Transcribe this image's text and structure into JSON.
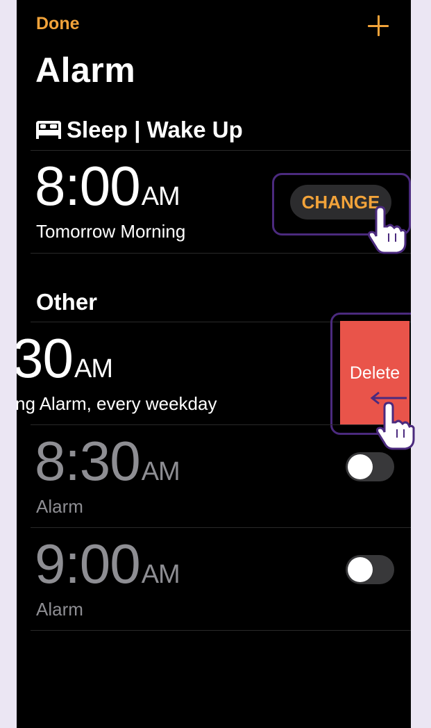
{
  "header": {
    "done_label": "Done",
    "add_icon": "plus-icon",
    "title": "Alarm"
  },
  "sleep": {
    "heading": "Sleep | Wake Up",
    "time": "8:00",
    "ampm": "AM",
    "label": "Tomorrow Morning",
    "change_label": "CHANGE"
  },
  "other": {
    "heading": "Other",
    "alarms": [
      {
        "time": "30",
        "ampm": "AM",
        "label": "ng Alarm, every weekday",
        "delete_label": "Delete"
      },
      {
        "time": "8:30",
        "ampm": "AM",
        "label": "Alarm",
        "enabled": false
      },
      {
        "time": "9:00",
        "ampm": "AM",
        "label": "Alarm",
        "enabled": false
      }
    ]
  },
  "colors": {
    "accent": "#f2a33a",
    "delete": "#e9544a",
    "highlight": "#4b2a7e",
    "background": "#000000"
  }
}
